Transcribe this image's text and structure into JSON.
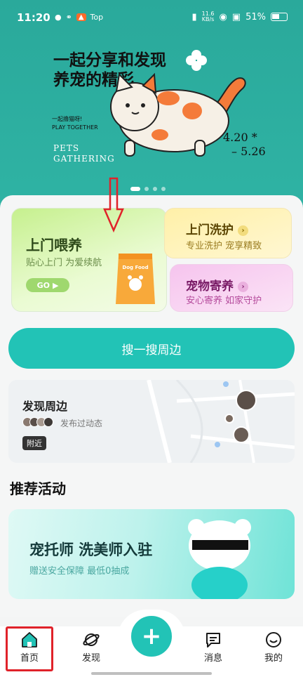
{
  "status_bar": {
    "time": "11:20",
    "network_speed": "11.6",
    "network_unit": "KB/s",
    "battery": "51%",
    "app_badge": "Top"
  },
  "banner": {
    "headline_line1": "一起分享和发现",
    "headline_line2": "养宠的精彩",
    "small_line1": "一起撸猫呀!",
    "small_line2": "PLAY TOGETHER",
    "pets_line1": "PETS",
    "pets_line2": "GATHERING",
    "date_line1": "4.20 *",
    "date_line2": "– 5.26",
    "carousel_count": 4,
    "carousel_active": 1
  },
  "services": {
    "feed": {
      "title": "上门喂养",
      "subtitle": "贴心上门 为爱续航",
      "go_label": "GO",
      "bag_label": "Dog Food"
    },
    "wash": {
      "title": "上门洗护",
      "subtitle": "专业洗护 宠享精致"
    },
    "board": {
      "title": "宠物寄养",
      "subtitle": "安心寄养 如家守护"
    }
  },
  "search_button": "搜一搜周边",
  "nearby": {
    "title": "发现周边",
    "posted": "发布过动态",
    "tag": "附近"
  },
  "recommend": {
    "section_title": "推荐活动",
    "promo_title": "宠托师 洗美师入驻",
    "promo_subtitle": "赠送安全保障 最低0抽成"
  },
  "nav": {
    "home": "首页",
    "discover": "发现",
    "messages": "消息",
    "mine": "我的"
  },
  "colors": {
    "brand": "#22c3b6",
    "banner": "#2aa99b",
    "annotation": "#e0222a"
  }
}
